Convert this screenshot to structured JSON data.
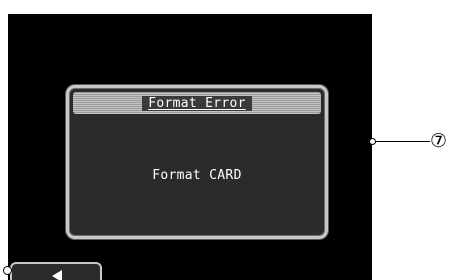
{
  "dialog": {
    "title": "Format Error",
    "message": "Format CARD"
  },
  "callout": {
    "label": "⑦"
  },
  "icons": {
    "back_button_icon": "left-arrow-icon"
  },
  "colors": {
    "screen_background": "#000000",
    "dialog_background": "#2b2b2b",
    "dialog_border": "#c8c8c8",
    "text": "#ffffff"
  }
}
